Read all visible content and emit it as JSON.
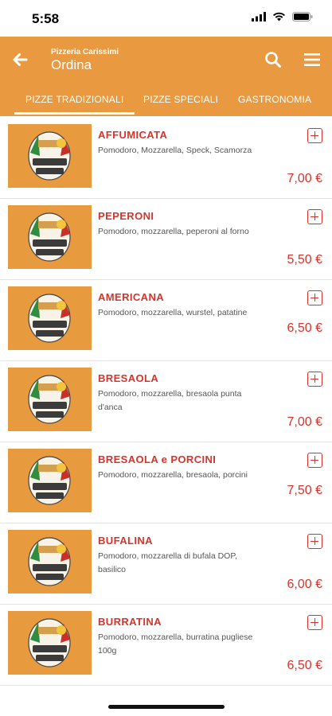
{
  "status": {
    "time": "5:58"
  },
  "header": {
    "subtitle": "Pizzeria Carissimi",
    "title": "Ordina",
    "tabs": [
      {
        "label": "PIZZE TRADIZIONALI",
        "active": true
      },
      {
        "label": "PIZZE SPECIALI",
        "active": false
      },
      {
        "label": "GASTRONOMIA",
        "active": false
      }
    ]
  },
  "colors": {
    "accent": "#E99A40",
    "price": "#D9332B"
  },
  "items": [
    {
      "name": "AFFUMICATA",
      "description": "Pomodoro, Mozzarella, Speck, Scamorza",
      "price": "7,00 €"
    },
    {
      "name": "PEPERONI",
      "description": "Pomodoro, mozzarella, peperoni al forno",
      "price": "5,50 €"
    },
    {
      "name": "AMERICANA",
      "description": "Pomodoro, mozzarella, wurstel, patatine",
      "price": "6,50 €"
    },
    {
      "name": "BRESAOLA",
      "description": "Pomodoro, mozzarella, bresaola punta d'anca",
      "price": "7,00 €"
    },
    {
      "name": "BRESAOLA e PORCINI",
      "description": "Pomodoro, mozzarella, bresaola, porcini",
      "price": "7,50 €"
    },
    {
      "name": "BUFALINA",
      "description": "Pomodoro, mozzarella di bufala DOP, basilico",
      "price": "6,00 €"
    },
    {
      "name": "BURRATINA",
      "description": "Pomodoro, mozzarella, burratina pugliese 100g",
      "price": "6,50 €"
    }
  ],
  "logo": {
    "text": "Pizzeria Carissimi"
  }
}
